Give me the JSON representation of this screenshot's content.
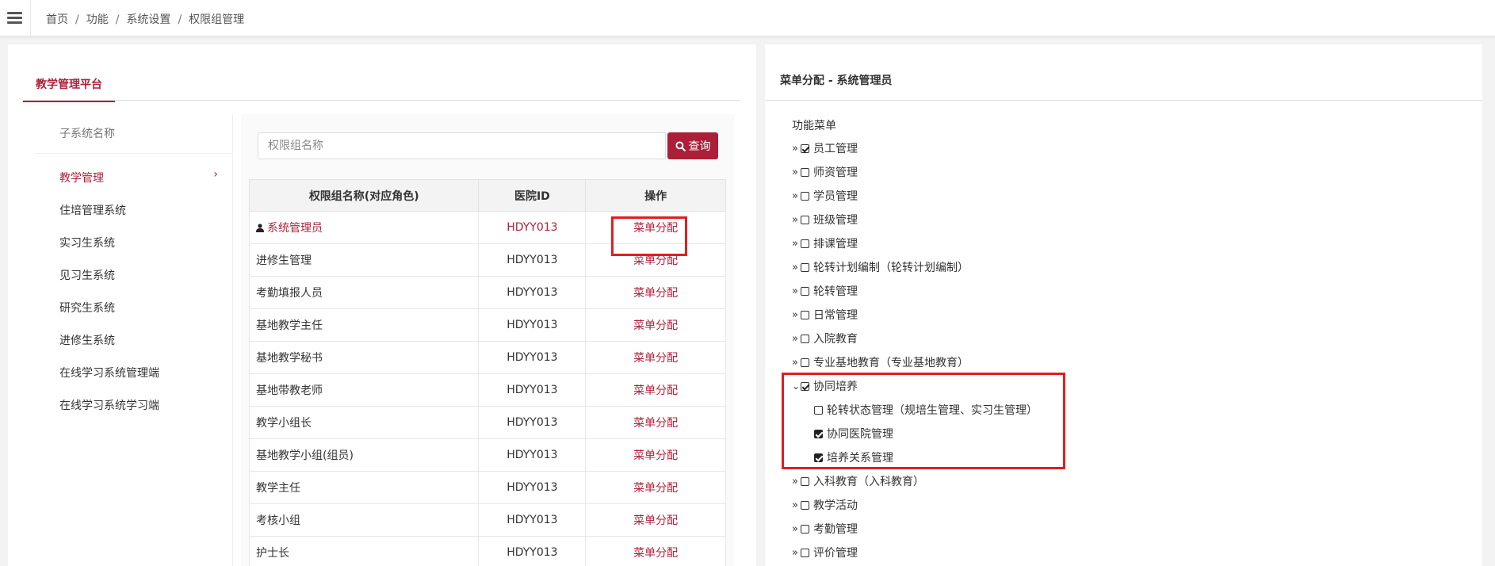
{
  "breadcrumb": [
    "首页",
    "功能",
    "系统设置",
    "权限组管理"
  ],
  "platform_tab": "教学管理平台",
  "subsystem": {
    "header": "子系统名称",
    "items": [
      {
        "label": "教学管理",
        "active": true
      },
      {
        "label": "住培管理系统"
      },
      {
        "label": "实习生系统"
      },
      {
        "label": "见习生系统"
      },
      {
        "label": "研究生系统"
      },
      {
        "label": "进修生系统"
      },
      {
        "label": "在线学习系统管理端"
      },
      {
        "label": "在线学习系统学习端"
      }
    ]
  },
  "search": {
    "placeholder": "权限组名称",
    "button_label": "查询",
    "icon": "search-icon"
  },
  "table": {
    "headers": [
      "权限组名称(对应角色)",
      "医院ID",
      "操作"
    ],
    "rows": [
      {
        "name": "系统管理员",
        "hospital_id": "HDYY013",
        "action": "菜单分配",
        "current": true,
        "icon": "user-icon"
      },
      {
        "name": "进修生管理",
        "hospital_id": "HDYY013",
        "action": "菜单分配"
      },
      {
        "name": "考勤填报人员",
        "hospital_id": "HDYY013",
        "action": "菜单分配"
      },
      {
        "name": "基地教学主任",
        "hospital_id": "HDYY013",
        "action": "菜单分配"
      },
      {
        "name": "基地教学秘书",
        "hospital_id": "HDYY013",
        "action": "菜单分配"
      },
      {
        "name": "基地带教老师",
        "hospital_id": "HDYY013",
        "action": "菜单分配"
      },
      {
        "name": "教学小组长",
        "hospital_id": "HDYY013",
        "action": "菜单分配"
      },
      {
        "name": "基地教学小组(组员)",
        "hospital_id": "HDYY013",
        "action": "菜单分配"
      },
      {
        "name": "教学主任",
        "hospital_id": "HDYY013",
        "action": "菜单分配"
      },
      {
        "name": "考核小组",
        "hospital_id": "HDYY013",
        "action": "菜单分配"
      },
      {
        "name": "护士长",
        "hospital_id": "HDYY013",
        "action": "菜单分配"
      }
    ]
  },
  "menu_panel": {
    "title": "菜单分配 - 系统管理员",
    "root": "功能菜单",
    "items": [
      {
        "label": "员工管理",
        "checked": true
      },
      {
        "label": "师资管理",
        "checked": false
      },
      {
        "label": "学员管理",
        "checked": false
      },
      {
        "label": "班级管理",
        "checked": false
      },
      {
        "label": "排课管理",
        "checked": false
      },
      {
        "label": "轮转计划编制（轮转计划编制）",
        "checked": false
      },
      {
        "label": "轮转管理",
        "checked": false
      },
      {
        "label": "日常管理",
        "checked": false
      },
      {
        "label": "入院教育",
        "checked": false
      },
      {
        "label": "专业基地教育（专业基地教育）",
        "checked": false
      },
      {
        "label": "协同培养",
        "checked": true,
        "expanded": true,
        "children": [
          {
            "label": "轮转状态管理（规培生管理、实习生管理）",
            "checked": false
          },
          {
            "label": "协同医院管理",
            "checked": true
          },
          {
            "label": "培养关系管理",
            "checked": true
          }
        ]
      },
      {
        "label": "入科教育（入科教育）",
        "checked": false
      },
      {
        "label": "教学活动",
        "checked": false
      },
      {
        "label": "考勤管理",
        "checked": false
      },
      {
        "label": "评价管理",
        "checked": false
      }
    ]
  },
  "colors": {
    "accent": "#b0213a",
    "button": "#ab1f38",
    "highlight": "#e01e1e"
  }
}
